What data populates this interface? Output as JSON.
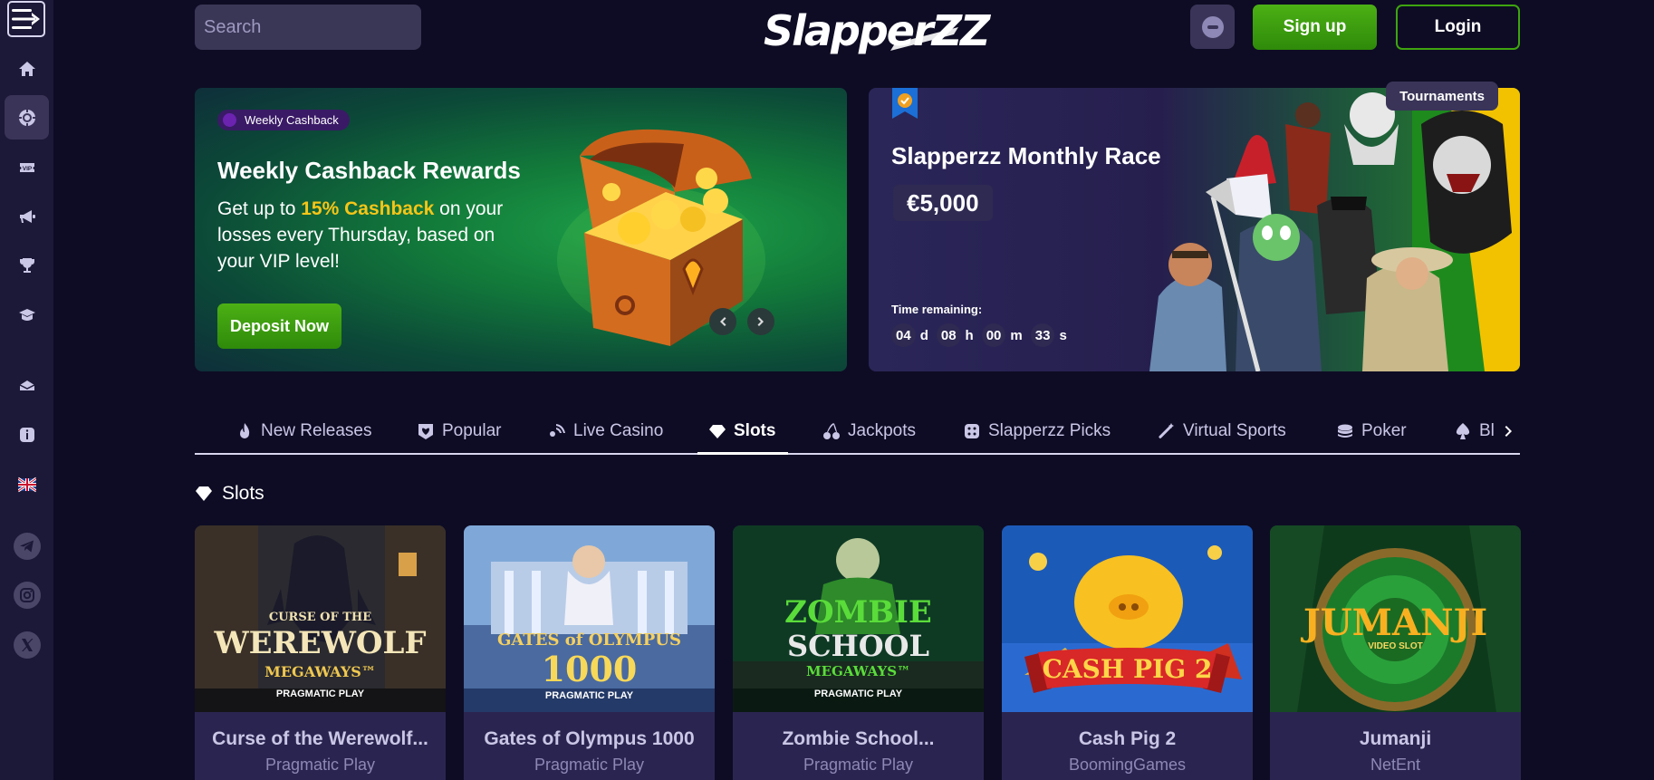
{
  "header": {
    "search_placeholder": "Search",
    "logo_text": "Slapper",
    "logo_zz": "ZZ",
    "signup_label": "Sign up",
    "login_label": "Login"
  },
  "sidebar": {
    "items": [
      {
        "icon": "menu-icon"
      },
      {
        "icon": "home-icon"
      },
      {
        "icon": "casino-chip-icon",
        "active": true
      },
      {
        "icon": "vip-icon"
      },
      {
        "icon": "megaphone-icon"
      },
      {
        "icon": "trophy-icon"
      },
      {
        "icon": "cashback-icon"
      },
      {
        "icon": "mail-icon"
      },
      {
        "icon": "info-icon"
      },
      {
        "icon": "uk-flag-icon"
      },
      {
        "icon": "telegram-icon"
      },
      {
        "icon": "instagram-icon"
      },
      {
        "icon": "x-icon"
      }
    ]
  },
  "promo": {
    "pill": "Weekly Cashback",
    "title": "Weekly Cashback Rewards",
    "text_before": "Get up to ",
    "highlight": "15% Cashback",
    "text_after": " on your losses every Thursday, based on your VIP level!",
    "cta": "Deposit Now"
  },
  "race": {
    "tag": "Tournaments",
    "title": "Slapperzz Monthly Race",
    "prize": "€5,000",
    "time_label": "Time remaining:",
    "days": "04",
    "days_unit": "d",
    "hours": "08",
    "hours_unit": "h",
    "minutes": "00",
    "minutes_unit": "m",
    "seconds": "33",
    "seconds_unit": "s"
  },
  "categories": [
    {
      "label": "New Releases",
      "icon": "flame-icon"
    },
    {
      "label": "Popular",
      "icon": "badge-icon"
    },
    {
      "label": "Live Casino",
      "icon": "live-icon"
    },
    {
      "label": "Slots",
      "icon": "diamond-icon",
      "active": true
    },
    {
      "label": "Jackpots",
      "icon": "cherries-icon"
    },
    {
      "label": "Slapperzz Picks",
      "icon": "dice-icon"
    },
    {
      "label": "Virtual Sports",
      "icon": "wand-icon"
    },
    {
      "label": "Poker",
      "icon": "poker-chips-icon"
    },
    {
      "label": "Bl",
      "icon": "spade-icon"
    }
  ],
  "section": {
    "title": "Slots"
  },
  "games": [
    {
      "name": "Curse of the Werewolf...",
      "provider": "Pragmatic Play",
      "thumb_line1": "CURSE OF THE",
      "thumb_line2": "WEREWOLF",
      "thumb_line3": "MEGAWAYS™",
      "thumb_sub": "PRAGMATIC PLAY"
    },
    {
      "name": "Gates of Olympus 1000",
      "provider": "Pragmatic Play",
      "thumb_line1": "GATES of OLYMPUS",
      "thumb_line2": "1000",
      "thumb_line3": "",
      "thumb_sub": "PRAGMATIC PLAY"
    },
    {
      "name": "Zombie School...",
      "provider": "Pragmatic Play",
      "thumb_line1": "ZOMBIE",
      "thumb_line2": "SCHOOL",
      "thumb_line3": "MEGAWAYS™",
      "thumb_sub": "PRAGMATIC PLAY"
    },
    {
      "name": "Cash Pig 2",
      "provider": "BoomingGames",
      "thumb_line1": "",
      "thumb_line2": "CASH PIG 2",
      "thumb_line3": "",
      "thumb_sub": ""
    },
    {
      "name": "Jumanji",
      "provider": "NetEnt",
      "thumb_line1": "",
      "thumb_line2": "JUMANJI",
      "thumb_line3": "VIDEO SLOT",
      "thumb_sub": ""
    }
  ],
  "colors": {
    "background": "#0e0c24",
    "sidebar": "#1c1838",
    "accent_green": "#3ea40f",
    "highlight_yellow": "#f5c518"
  }
}
